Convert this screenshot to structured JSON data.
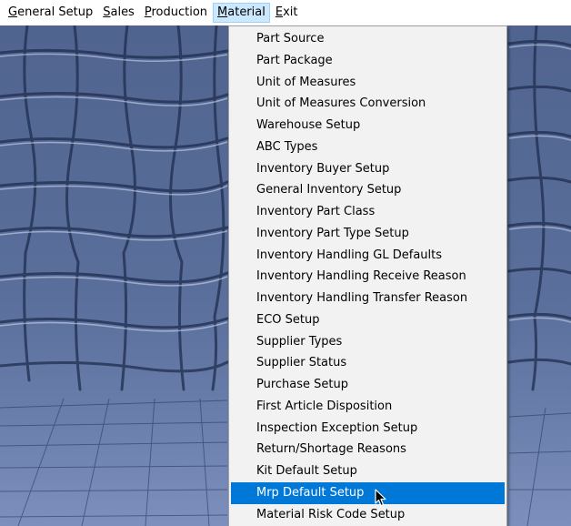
{
  "menubar": {
    "items": [
      {
        "pre": "",
        "mn": "G",
        "post": "eneral Setup"
      },
      {
        "pre": "",
        "mn": "S",
        "post": "ales"
      },
      {
        "pre": "",
        "mn": "P",
        "post": "roduction"
      },
      {
        "pre": "",
        "mn": "M",
        "post": "aterial"
      },
      {
        "pre": "",
        "mn": "E",
        "post": "xit"
      }
    ],
    "open_menu": "Material"
  },
  "material_menu": {
    "items": [
      "Part Source",
      "Part Package",
      "Unit of Measures",
      "Unit of Measures Conversion",
      "Warehouse Setup",
      "ABC Types",
      "Inventory Buyer Setup",
      "General Inventory Setup",
      "Inventory Part Class",
      "Inventory Part Type Setup",
      "Inventory Handling GL Defaults",
      "Inventory Handling Receive Reason",
      "Inventory Handling Transfer Reason",
      "ECO Setup",
      "Supplier Types",
      "Supplier Status",
      "Purchase Setup",
      "First Article Disposition",
      "Inspection Exception Setup",
      "Return/Shortage Reasons",
      "Kit Default Setup",
      "Mrp Default Setup",
      "Material Risk Code Setup"
    ],
    "selected": "Mrp Default Setup"
  },
  "colors": {
    "highlight": "#0078d7",
    "menu_background": "#f2f2f2",
    "desktop": "#5a6e9b"
  },
  "cursor_icon": "arrow-pointer-icon",
  "background_icon": "stone-wall-texture"
}
